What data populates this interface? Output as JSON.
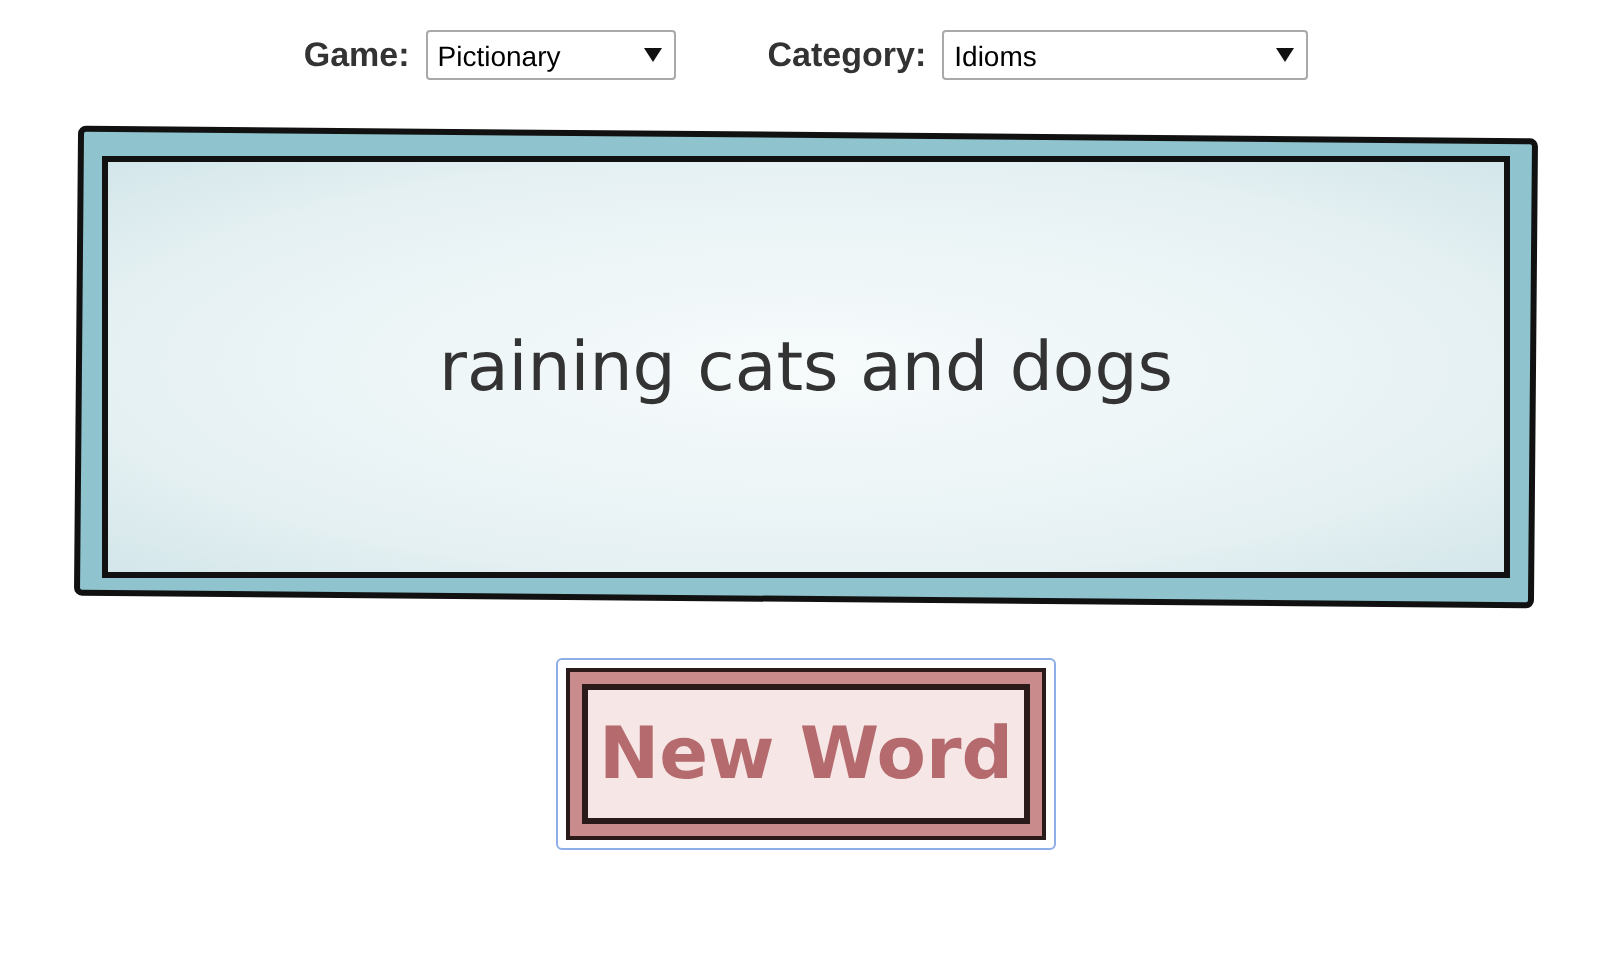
{
  "controls": [
    {
      "label": "Game:",
      "value": "Pictionary"
    },
    {
      "label": "Category:",
      "value": "Idioms"
    }
  ],
  "card": {
    "word": "raining cats and dogs"
  },
  "button": {
    "label": "New Word",
    "focused": true
  }
}
